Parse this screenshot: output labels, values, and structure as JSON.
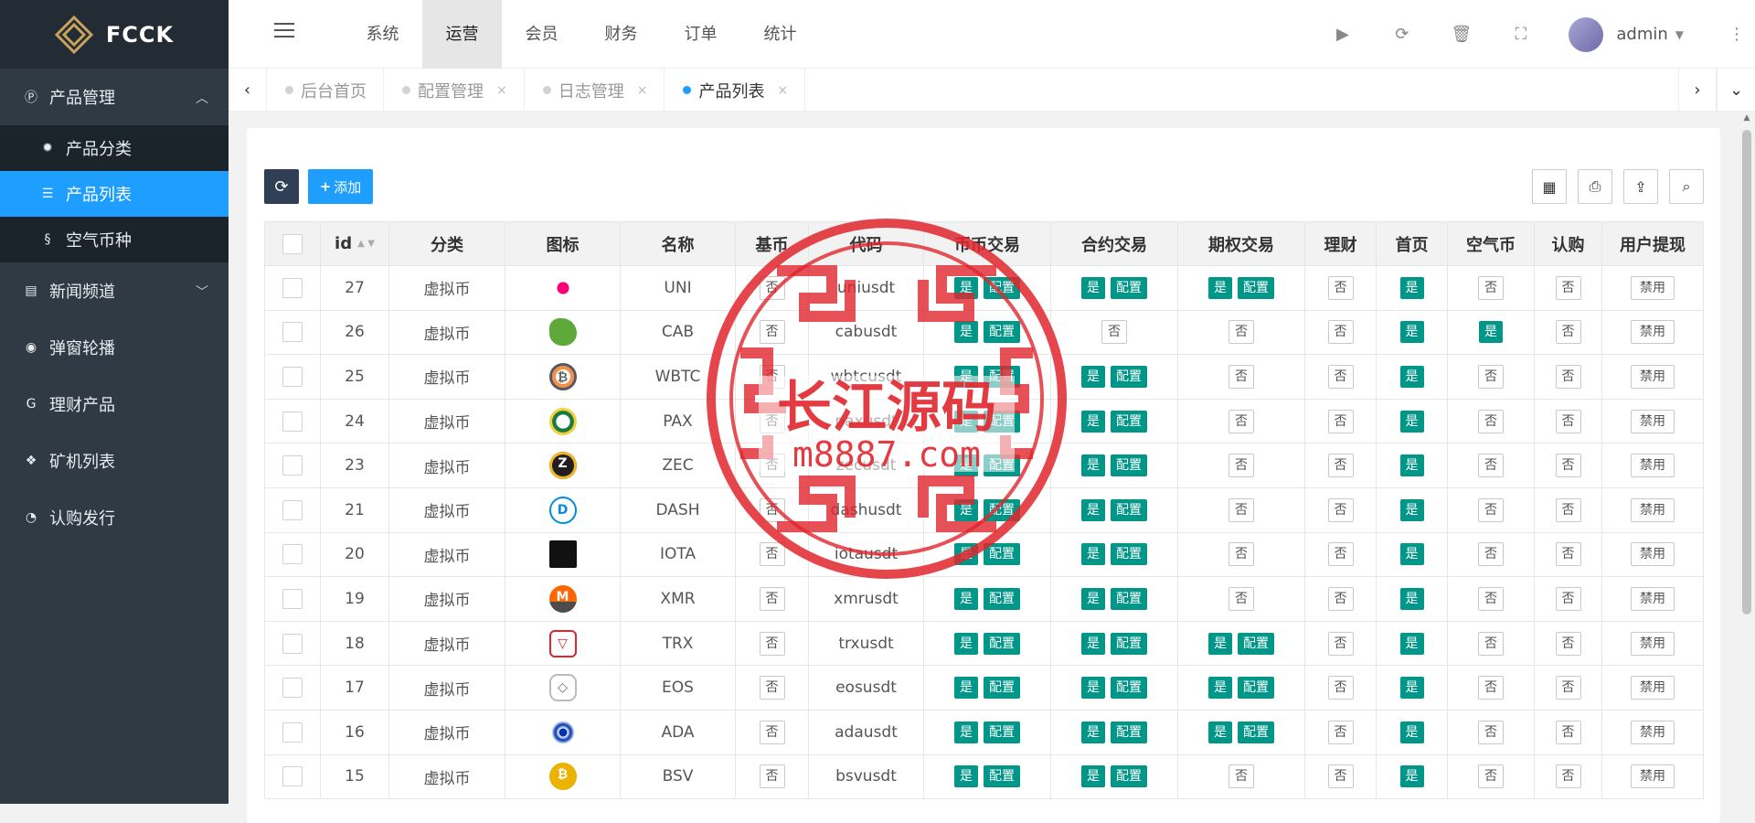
{
  "app": {
    "brand": "FCCK"
  },
  "sidebar": {
    "groups": [
      {
        "label": "产品管理",
        "icon": "p-circle-icon",
        "expanded": true,
        "children": [
          {
            "label": "产品分类",
            "icon": "gear-icon"
          },
          {
            "label": "产品列表",
            "icon": "list-icon",
            "active": true
          },
          {
            "label": "空气币种",
            "icon": "coin-icon"
          }
        ]
      },
      {
        "label": "新闻频道",
        "icon": "news-icon",
        "expanded": false
      },
      {
        "label": "弹窗轮播",
        "icon": "compass-icon"
      },
      {
        "label": "理财产品",
        "icon": "g-icon"
      },
      {
        "label": "矿机列表",
        "icon": "cubes-icon"
      },
      {
        "label": "认购发行",
        "icon": "pie-icon"
      }
    ]
  },
  "topnav": {
    "items": [
      "系统",
      "运营",
      "会员",
      "财务",
      "订单",
      "统计"
    ],
    "active": "运营"
  },
  "header": {
    "username": "admin"
  },
  "tabs": {
    "items": [
      {
        "label": "后台首页",
        "closable": false,
        "active": false
      },
      {
        "label": "配置管理",
        "closable": true,
        "active": false
      },
      {
        "label": "日志管理",
        "closable": true,
        "active": false
      },
      {
        "label": "产品列表",
        "closable": true,
        "active": true
      }
    ]
  },
  "toolbar": {
    "add_label": "添加"
  },
  "table": {
    "columns": [
      "id",
      "分类",
      "图标",
      "名称",
      "基币",
      "代码",
      "币币交易",
      "合约交易",
      "期权交易",
      "理财",
      "首页",
      "空气币",
      "认购",
      "用户提现"
    ],
    "labels": {
      "yes": "是",
      "no": "否",
      "config": "配置",
      "disable": "禁用"
    },
    "rows": [
      {
        "id": "27",
        "category": "虚拟币",
        "icon": "uni",
        "name": "UNI",
        "base": "否",
        "code": "uniusdt",
        "spot": "是",
        "contract": "是",
        "option": "是",
        "finance": "否",
        "home": "是",
        "airdrop": "否",
        "subscribe": "否",
        "withdraw": "禁用"
      },
      {
        "id": "26",
        "category": "虚拟币",
        "icon": "cab",
        "name": "CAB",
        "base": "否",
        "code": "cabusdt",
        "spot": "是",
        "contract": "否",
        "option": "否",
        "finance": "否",
        "home": "是",
        "airdrop": "是",
        "subscribe": "否",
        "withdraw": "禁用"
      },
      {
        "id": "25",
        "category": "虚拟币",
        "icon": "wbtc",
        "name": "WBTC",
        "base": "否",
        "code": "wbtcusdt",
        "spot": "是",
        "contract": "是",
        "option": "否",
        "finance": "否",
        "home": "是",
        "airdrop": "否",
        "subscribe": "否",
        "withdraw": "禁用"
      },
      {
        "id": "24",
        "category": "虚拟币",
        "icon": "pax",
        "name": "PAX",
        "base": "否",
        "code": "paxusdt",
        "spot": "是",
        "contract": "是",
        "option": "否",
        "finance": "否",
        "home": "是",
        "airdrop": "否",
        "subscribe": "否",
        "withdraw": "禁用"
      },
      {
        "id": "23",
        "category": "虚拟币",
        "icon": "zec",
        "name": "ZEC",
        "base": "否",
        "code": "zecusdt",
        "spot": "是",
        "contract": "是",
        "option": "否",
        "finance": "否",
        "home": "是",
        "airdrop": "否",
        "subscribe": "否",
        "withdraw": "禁用"
      },
      {
        "id": "21",
        "category": "虚拟币",
        "icon": "dash",
        "name": "DASH",
        "base": "否",
        "code": "dashusdt",
        "spot": "是",
        "contract": "是",
        "option": "否",
        "finance": "否",
        "home": "是",
        "airdrop": "否",
        "subscribe": "否",
        "withdraw": "禁用"
      },
      {
        "id": "20",
        "category": "虚拟币",
        "icon": "iota",
        "name": "IOTA",
        "base": "否",
        "code": "iotausdt",
        "spot": "是",
        "contract": "是",
        "option": "否",
        "finance": "否",
        "home": "是",
        "airdrop": "否",
        "subscribe": "否",
        "withdraw": "禁用"
      },
      {
        "id": "19",
        "category": "虚拟币",
        "icon": "xmr",
        "name": "XMR",
        "base": "否",
        "code": "xmrusdt",
        "spot": "是",
        "contract": "是",
        "option": "否",
        "finance": "否",
        "home": "是",
        "airdrop": "否",
        "subscribe": "否",
        "withdraw": "禁用"
      },
      {
        "id": "18",
        "category": "虚拟币",
        "icon": "trx",
        "name": "TRX",
        "base": "否",
        "code": "trxusdt",
        "spot": "是",
        "contract": "是",
        "option": "是",
        "finance": "否",
        "home": "是",
        "airdrop": "否",
        "subscribe": "否",
        "withdraw": "禁用"
      },
      {
        "id": "17",
        "category": "虚拟币",
        "icon": "eos",
        "name": "EOS",
        "base": "否",
        "code": "eosusdt",
        "spot": "是",
        "contract": "是",
        "option": "是",
        "finance": "否",
        "home": "是",
        "airdrop": "否",
        "subscribe": "否",
        "withdraw": "禁用"
      },
      {
        "id": "16",
        "category": "虚拟币",
        "icon": "ada",
        "name": "ADA",
        "base": "否",
        "code": "adausdt",
        "spot": "是",
        "contract": "是",
        "option": "是",
        "finance": "否",
        "home": "是",
        "airdrop": "否",
        "subscribe": "否",
        "withdraw": "禁用"
      },
      {
        "id": "15",
        "category": "虚拟币",
        "icon": "bsv",
        "name": "BSV",
        "base": "否",
        "code": "bsvusdt",
        "spot": "是",
        "contract": "是",
        "option": "否",
        "finance": "否",
        "home": "是",
        "airdrop": "否",
        "subscribe": "否",
        "withdraw": "禁用"
      }
    ]
  },
  "watermark": {
    "line1": "长江源码",
    "line2": "m8887.com"
  },
  "colors": {
    "sidebar": "#2f3a45",
    "accent": "#1e9fff",
    "teal": "#009688",
    "stamp": "#e0262d"
  }
}
